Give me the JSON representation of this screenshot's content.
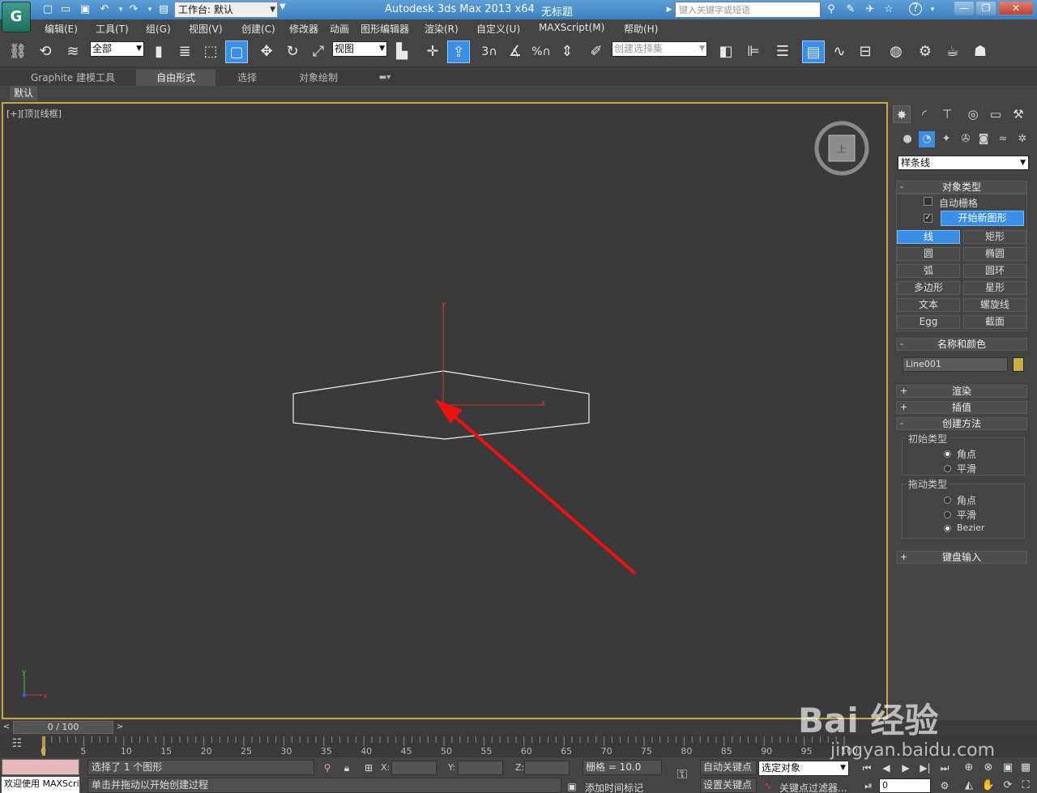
{
  "titlebar": {
    "logo_glyph": "G",
    "workspace_label": "工作台: 默认",
    "app_title": "Autodesk 3ds Max  2013 x64",
    "doc_title": "无标题",
    "search_placeholder": "键入关键字或短语",
    "help_glyph": "?",
    "minimize_glyph": "—",
    "restore_glyph": "❐",
    "close_glyph": "✕"
  },
  "menu": {
    "items": [
      "编辑(E)",
      "工具(T)",
      "组(G)",
      "视图(V)",
      "创建(C)",
      "修改器",
      "动画",
      "图形编辑器",
      "渲染(R)",
      "自定义(U)",
      "MAXScript(M)",
      "帮助(H)"
    ]
  },
  "toolbar": {
    "selection_filter": "全部",
    "ref_coord": "视图",
    "named_selection": "创建选择集",
    "snap_labels": [
      "3",
      "%"
    ]
  },
  "ribbon": {
    "tabs": [
      "Graphite 建模工具",
      "自由形式",
      "选择",
      "对象绘制"
    ],
    "active_tab": 1,
    "sub_label": "默认"
  },
  "viewport": {
    "label": "[+][顶][线框]",
    "viewcube_face": "上",
    "axis_x": "x",
    "axis_y": "y"
  },
  "command_panel": {
    "category": "样条线",
    "rollouts": {
      "object_type": {
        "title": "对象类型",
        "auto_grid": "自动栅格",
        "start_new_shape": "开始新图形",
        "buttons": [
          "线",
          "矩形",
          "圆",
          "椭圆",
          "弧",
          "圆环",
          "多边形",
          "星形",
          "文本",
          "螺旋线",
          "Egg",
          "截面"
        ],
        "active_button": 0
      },
      "name_color": {
        "title": "名称和颜色",
        "name_value": "Line001",
        "swatch_color": "#c8b040"
      },
      "render": {
        "title": "渲染"
      },
      "interpolation": {
        "title": "插值"
      },
      "creation_method": {
        "title": "创建方法",
        "initial_type": {
          "title": "初始类型",
          "options": [
            "角点",
            "平滑"
          ],
          "selected": 0
        },
        "drag_type": {
          "title": "拖动类型",
          "options": [
            "角点",
            "平滑",
            "Bezier"
          ],
          "selected": 2
        }
      },
      "keyboard_entry": {
        "title": "键盘输入"
      }
    }
  },
  "timeline": {
    "frame_counter": "0 / 100",
    "ticks": [
      "0",
      "5",
      "10",
      "15",
      "20",
      "25",
      "30",
      "35",
      "40",
      "45",
      "50",
      "55",
      "60",
      "65",
      "70",
      "75",
      "80",
      "85",
      "90",
      "95",
      "100"
    ]
  },
  "statusbar": {
    "listener_text": "欢迎使用 MAXScript",
    "selection_status": "选择了 1 个图形",
    "prompt": "单击并拖动以开始创建过程",
    "x_label": "X:",
    "y_label": "Y:",
    "z_label": "Z:",
    "grid": "栅格 = 10.0",
    "add_time_tag": "添加时间标记",
    "auto_key": "自动关键点",
    "set_key": "设置关键点",
    "key_filter_target": "选定对象",
    "key_filters": "关键点过滤器...",
    "current_frame": "0"
  },
  "watermark": {
    "main": "Bai 经验",
    "sub": "jingyan.baidu.com"
  },
  "annotation_color": "#ee1111"
}
